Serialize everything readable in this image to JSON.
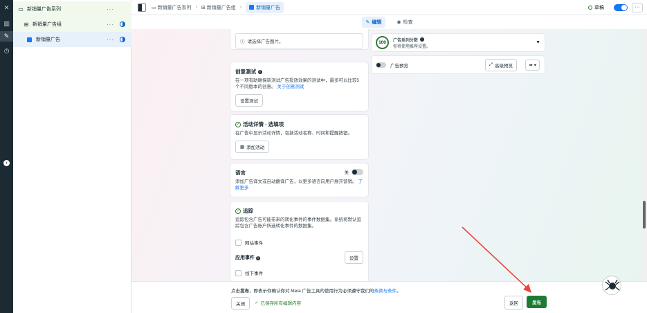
{
  "tree": {
    "campaign": "新销量广告系列",
    "adset": "新销量广告组",
    "ad": "新销量广告"
  },
  "breadcrumb": {
    "campaign": "新销量广告系列",
    "adset": "新销量广告组",
    "ad": "新销量广告"
  },
  "status": {
    "label": "草稿"
  },
  "tabs": {
    "edit": "编辑",
    "review": "检查"
  },
  "image_hint": "请选择广告图片。",
  "creative_test": {
    "title": "创意测试",
    "desc": "在一项有助确保新测试广告投放效果的测试中，最多可以比较5个不同版本的创意。",
    "link": "关于创意测试",
    "button": "设置测试"
  },
  "activity": {
    "title": "活动详情 · 选填项",
    "desc": "在广告中显示活动详情，包括活动名称、时间和提醒按钮。",
    "button": "添加活动"
  },
  "language": {
    "title": "语言",
    "switch_label": "关",
    "desc": "添加广告译文或自动翻译广告，以更多语言向用户展开营销。",
    "link": "了解更多"
  },
  "tracking": {
    "title": "追踪",
    "desc": "追踪包含广告可能带来的转化事件的事件数据集。系统将默认追踪包含广告账户所选转化事件的数据集。",
    "website_events": "网站事件",
    "app_events": "应用事件",
    "app_button": "设置",
    "offline_events": "线下事件"
  },
  "score": {
    "value": "100",
    "title": "广告系列分数",
    "subtitle": "你将使用推荐设置。"
  },
  "preview": {
    "label": "广告预览",
    "advanced": "高级预览"
  },
  "bottom": {
    "terms_prefix": "点击",
    "terms_bold": "发布",
    "terms_mid": "，即表示你确认你对 Meta 广告工具的使用行为必须遵守我们的",
    "terms_link": "条款与条件",
    "terms_suffix": "。",
    "close": "关闭",
    "saved": "已保存所有编辑内容",
    "back": "返回",
    "publish": "发布"
  },
  "colors": {
    "accent": "#1877f2",
    "publish": "#1e7b34",
    "arrow": "#e8463a"
  }
}
